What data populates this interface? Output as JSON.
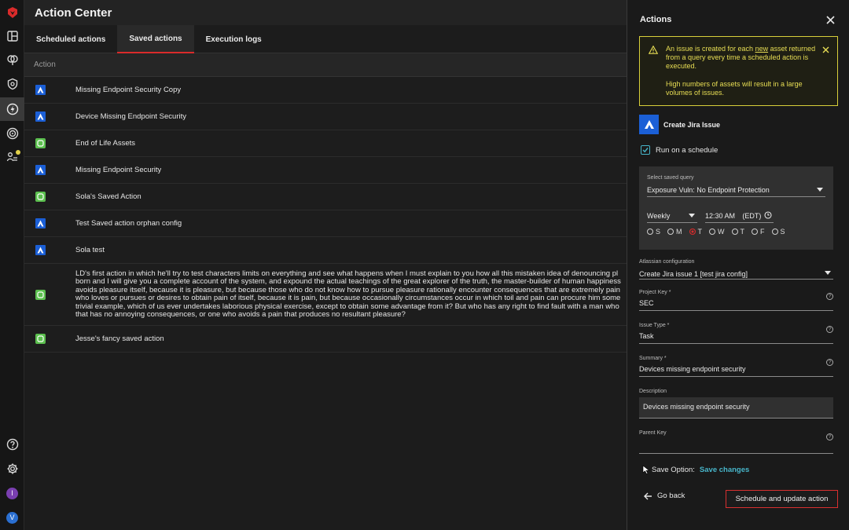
{
  "rail": {
    "items": [
      {
        "name": "logo-icon"
      },
      {
        "name": "dashboard-icon"
      },
      {
        "name": "brain-icon"
      },
      {
        "name": "shield-icon"
      },
      {
        "name": "lightning-icon"
      },
      {
        "name": "radar-icon"
      },
      {
        "name": "people-icon"
      }
    ],
    "bottom": {
      "help": "help-icon",
      "settings": "gear-icon",
      "avatar1": "I",
      "avatar2": "V"
    }
  },
  "main": {
    "title": "Action Center",
    "tabs": [
      {
        "label": "Scheduled actions"
      },
      {
        "label": "Saved actions"
      },
      {
        "label": "Execution logs"
      }
    ],
    "column_header": "Action",
    "rows": [
      {
        "type": "jira",
        "name": "Missing Endpoint Security Copy"
      },
      {
        "type": "jira",
        "name": "Device Missing Endpoint Security"
      },
      {
        "type": "green",
        "name": "End of Life Assets"
      },
      {
        "type": "jira",
        "name": "Missing Endpoint Security"
      },
      {
        "type": "green",
        "name": "Sola's Saved Action"
      },
      {
        "type": "jira",
        "name": "Test Saved action orphan config"
      },
      {
        "type": "jira",
        "name": "Sola test"
      },
      {
        "type": "green",
        "name": "LD's first action in which he'll try to test characters limits on everything and see what happens when I must explain to you how all this mistaken idea of denouncing pl born and I will give you a complete account of the system, and expound the actual teachings of the great explorer of the truth, the master-builder of human happiness avoids pleasure itself, because it is pleasure, but because those who do not know how to pursue pleasure rationally encounter consequences that are extremely pain who loves or pursues or desires to obtain pain of itself, because it is pain, but because occasionally circumstances occur in which toil and pain can procure him some trivial example, which of us ever undertakes laborious physical exercise, except to obtain some advantage from it? But who has any right to find fault with a man who that has no annoying consequences, or one who avoids a pain that produces no resultant pleasure?"
      },
      {
        "type": "green",
        "name": "Jesse's fancy saved action"
      }
    ]
  },
  "panel": {
    "title": "Actions",
    "warning": {
      "line1_pre": "An issue is created for each ",
      "line1_link": "new",
      "line1_post": " asset returned from a query every time a scheduled action is executed.",
      "line2": "High numbers of assets will result in a large volumes of issues."
    },
    "integration_title": "Create Jira Issue",
    "run_on_schedule": "Run on a schedule",
    "saved_query_label": "Select saved query",
    "saved_query_value": "Exposure Vuln: No Endpoint Protection",
    "frequency": "Weekly",
    "time": "12:30 AM",
    "timezone": "(EDT)",
    "days": [
      {
        "label": "S",
        "on": false
      },
      {
        "label": "M",
        "on": false
      },
      {
        "label": "T",
        "on": true
      },
      {
        "label": "W",
        "on": false
      },
      {
        "label": "T",
        "on": false
      },
      {
        "label": "F",
        "on": false
      },
      {
        "label": "S",
        "on": false
      }
    ],
    "atlassian_label": "Atlassian configuration",
    "atlassian_value": "Create Jira issue 1 [test jira config]",
    "project_key_label": "Project Key *",
    "project_key_value": "SEC",
    "issue_type_label": "Issue Type *",
    "issue_type_value": "Task",
    "summary_label": "Summary *",
    "summary_value": "Devices missing endpoint security",
    "description_label": "Description",
    "description_value": "Devices missing endpoint security",
    "parent_key_label": "Parent Key",
    "parent_key_value": "",
    "save_option_label": "Save Option:",
    "save_option_value": "Save changes",
    "back_label": "Go back",
    "primary_label": "Schedule and update action"
  },
  "colors": {
    "accent_red": "#d92b2b",
    "jira_blue": "#1b5fd6",
    "teal": "#47b5c9",
    "warning_yellow": "#d8cf3a"
  }
}
